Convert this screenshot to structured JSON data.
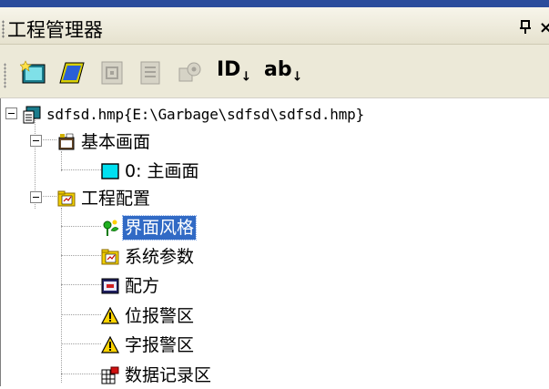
{
  "panel": {
    "title": "工程管理器",
    "pin_symbol": "ф",
    "close_symbol": "×"
  },
  "toolbar": {
    "id_label": "ID",
    "ab_label": "ab"
  },
  "tree": {
    "root": "sdfsd.hmp{E:\\Garbage\\sdfsd\\sdfsd.hmp}",
    "screens_group": "基本画面",
    "screen_0": "0: 主画面",
    "config_group": "工程配置",
    "items": [
      "界面风格",
      "系统参数",
      "配方",
      "位报警区",
      "字报警区",
      "数据记录区"
    ]
  },
  "colors": {
    "selection": "#316ac5",
    "title_bg": "#ece9d8",
    "accent_blue": "#2b4d9b"
  }
}
